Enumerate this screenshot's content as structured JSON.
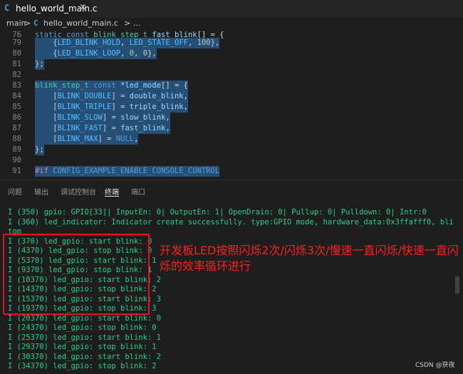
{
  "tab": {
    "icon": "C",
    "filename": "hello_world_main.c",
    "close": "×"
  },
  "breadcrumb": {
    "folder": "main",
    "sep1": ">",
    "icon": "C",
    "file": "hello_world_main.c",
    "sep2": ">",
    "more": "..."
  },
  "editor": {
    "line76": {
      "num": "76",
      "t1": "static",
      "t2": " const ",
      "t3": "blink_step_t",
      "t4": " fast_blink",
      "t5": "[] = {"
    },
    "line79": {
      "num": "79",
      "t1": "    {",
      "t2": "LED_BLINK_HOLD",
      "t3": ", ",
      "t4": "LED_STATE_OFF",
      "t5": ", ",
      "t6": "100",
      "t7": "},"
    },
    "line80": {
      "num": "80",
      "t1": "    {",
      "t2": "LED_BLINK_LOOP",
      "t3": ", ",
      "t4": "0",
      "t5": ", ",
      "t6": "0",
      "t7": "},"
    },
    "line81": {
      "num": "81",
      "t1": "};"
    },
    "line82": {
      "num": "82"
    },
    "line83": {
      "num": "83",
      "t1": "blink_step_t",
      "t2": " const ",
      "t3": "*led_mode",
      "t4": "[] = {"
    },
    "line84": {
      "num": "84",
      "t1": "    [",
      "t2": "BLINK_DOUBLE",
      "t3": "] = ",
      "t4": "double_blink",
      "t5": ","
    },
    "line85": {
      "num": "85",
      "t1": "    [",
      "t2": "BLINK_TRIPLE",
      "t3": "] = ",
      "t4": "triple_blink",
      "t5": ","
    },
    "line86": {
      "num": "86",
      "t1": "    [",
      "t2": "BLINK_SLOW",
      "t3": "] = ",
      "t4": "slow_blink",
      "t5": ","
    },
    "line87": {
      "num": "87",
      "t1": "    [",
      "t2": "BLINK_FAST",
      "t3": "] = ",
      "t4": "fast_blink",
      "t5": ","
    },
    "line88": {
      "num": "88",
      "t1": "    [",
      "t2": "BLINK_MAX",
      "t3": "] = ",
      "t4": "NULL",
      "t5": ","
    },
    "line89": {
      "num": "89",
      "t1": "};"
    },
    "line90": {
      "num": "90"
    },
    "line91": {
      "num": "91",
      "t1": "#if",
      "t2": " CONFIG_EXAMPLE_ENABLE_CONSOLE_CONTROL"
    }
  },
  "panel_tabs": {
    "problems": "问题",
    "output": "输出",
    "debug_console": "调试控制台",
    "terminal": "终端",
    "ports": "端口"
  },
  "terminal_lines": [
    "I (350) gpio: GPIO[33]| InputEn: 0| OutputEn: 1| OpenDrain: 0| Pullup: 0| Pulldown: 0| Intr:0",
    "I (360) led_indicator: Indicator create successfully. type:GPIO mode, hardware_data:0x3ffafff0, blink_lists:cus",
    "tom",
    "I (370) led_gpio: start blink: 0",
    "I (4370) led_gpio: stop blink: 0",
    "I (5370) led_gpio: start blink: 1",
    "I (9370) led_gpio: stop blink: 1",
    "I (10370) led_gpio: start blink: 2",
    "I (14370) led_gpio: stop blink: 2",
    "I (15370) led_gpio: start blink: 3",
    "I (19370) led_gpio: stop blink: 3",
    "I (20370) led_gpio: start blink: 0",
    "I (24370) led_gpio: stop blink: 0",
    "I (25370) led_gpio: start blink: 1",
    "I (29370) led_gpio: stop blink: 1",
    "I (30370) led_gpio: start blink: 2",
    "I (34370) led_gpio: stop blink: 2"
  ],
  "annotation": "开发板LED按照闪烁2次/闪烁3次/慢速一直闪烁/快速一直闪烁的效率循环进行",
  "watermark": "CSDN @获夜",
  "colors": {
    "terminal_text": "#23d18b",
    "highlight_box": "#e81123",
    "annotation": "#ff2020",
    "selection": "#264f78"
  }
}
